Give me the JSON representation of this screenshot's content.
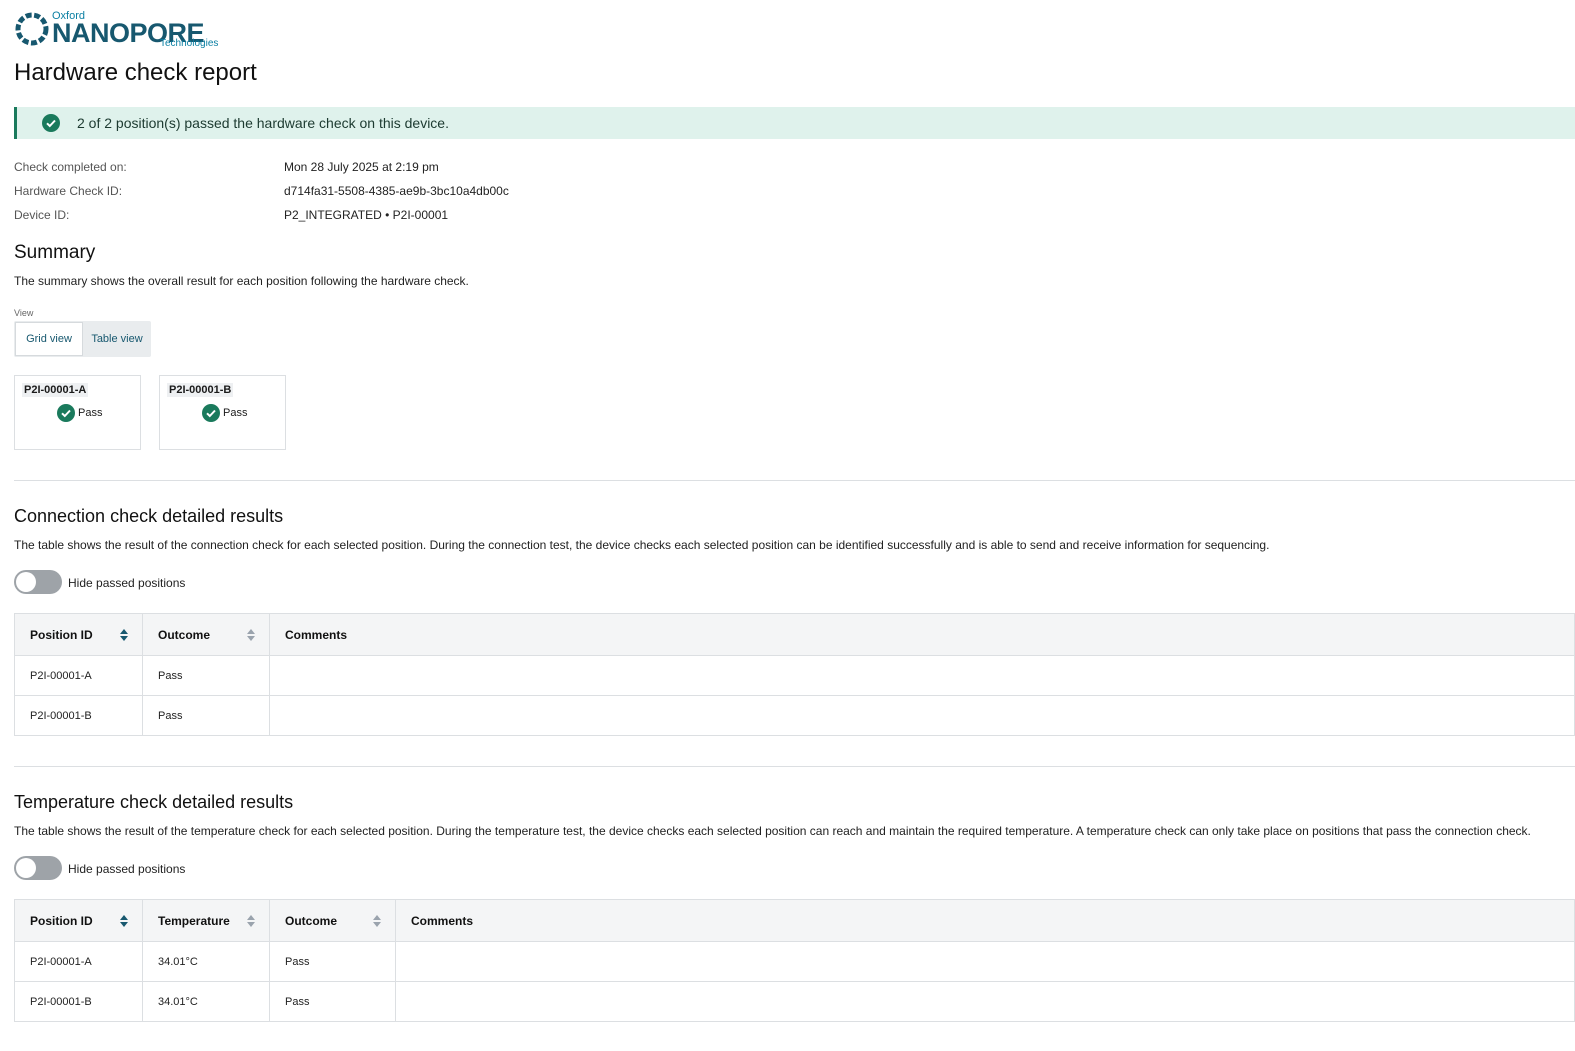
{
  "logo": {
    "oxford": "Oxford",
    "main": "NANOPORE",
    "tech": "Technologies"
  },
  "page_title": "Hardware check report",
  "banner": {
    "text": "2 of 2 position(s) passed the hardware check on this device.",
    "color": "#1a7a5c",
    "bg": "#dff2ec"
  },
  "meta": [
    {
      "label": "Check completed on:",
      "value": "Mon 28 July 2025 at 2:19 pm"
    },
    {
      "label": "Hardware Check ID:",
      "value": "d714fa31-5508-4385-ae9b-3bc10a4db00c"
    },
    {
      "label": "Device ID:",
      "value": "P2_INTEGRATED • P2I-00001"
    }
  ],
  "summary": {
    "title": "Summary",
    "description": "The summary shows the overall result for each position following the hardware check.",
    "view_label": "View",
    "views": [
      "Grid view",
      "Table view"
    ],
    "selected_view": "Grid view",
    "cards": [
      {
        "id": "P2I-00001-A",
        "status": "Pass"
      },
      {
        "id": "P2I-00001-B",
        "status": "Pass"
      }
    ]
  },
  "connection": {
    "title": "Connection check detailed results",
    "description": "The table shows the result of the connection check for each selected position. During the connection test, the device checks each selected position can be identified successfully and is able to send and receive information for sequencing.",
    "toggle_label": "Hide passed positions",
    "toggle_on": false,
    "columns": [
      "Position ID",
      "Outcome",
      "Comments"
    ],
    "rows": [
      [
        "P2I-00001-A",
        "Pass",
        ""
      ],
      [
        "P2I-00001-B",
        "Pass",
        ""
      ]
    ]
  },
  "temperature": {
    "title": "Temperature check detailed results",
    "description": "The table shows the result of the temperature check for each selected position. During the temperature test, the device checks each selected position can reach and maintain the required temperature. A temperature check can only take place on positions that pass the connection check.",
    "toggle_label": "Hide passed positions",
    "toggle_on": false,
    "columns": [
      "Position ID",
      "Temperature",
      "Outcome",
      "Comments"
    ],
    "rows": [
      [
        "P2I-00001-A",
        "34.01°C",
        "Pass",
        ""
      ],
      [
        "P2I-00001-B",
        "34.01°C",
        "Pass",
        ""
      ]
    ]
  },
  "icons": {
    "pass": "check-circle-icon",
    "sort": "sort-icon",
    "logo": "nanopore-logo-icon"
  }
}
